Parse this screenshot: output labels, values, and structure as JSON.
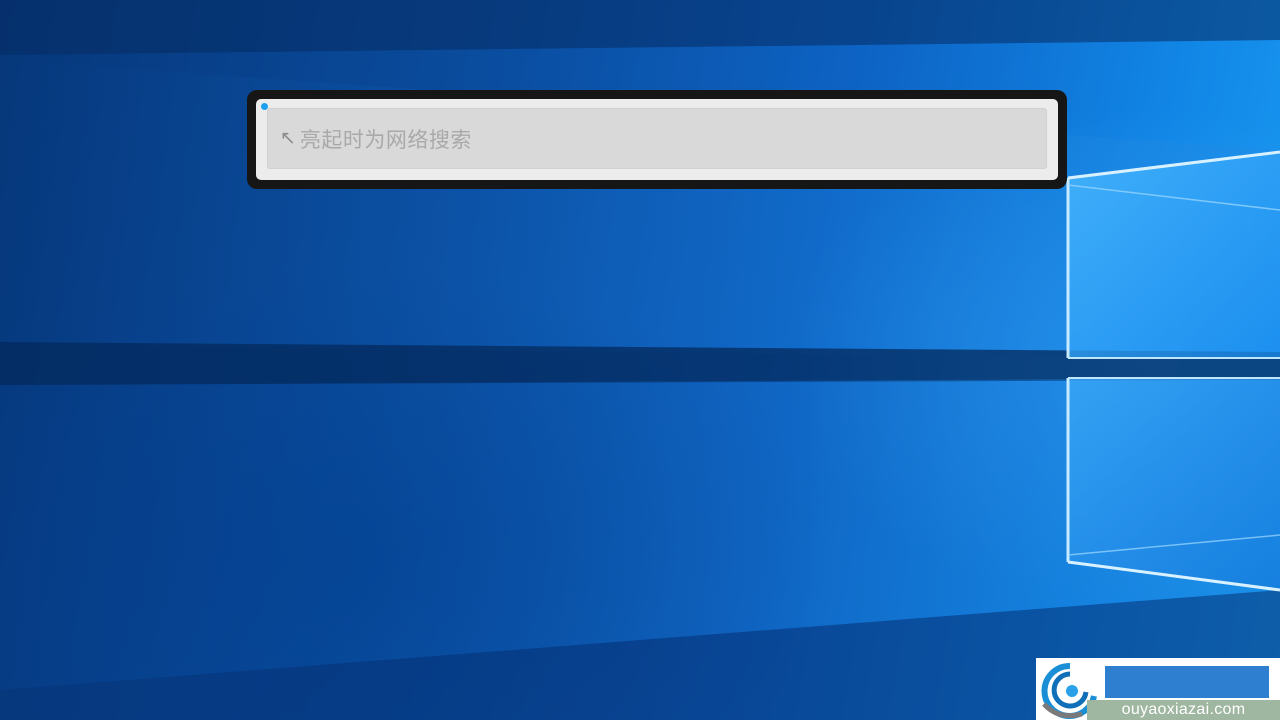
{
  "search": {
    "cursor_glyph": "↖",
    "placeholder": "亮起时为网络搜索"
  },
  "watermark": {
    "site": "ouyaoxiazai.com"
  },
  "colors": {
    "wallpaper_dark": "#06377a",
    "wallpaper_light": "#1a9cf2",
    "frame": "#161616",
    "panel": "#ececec",
    "field": "#d9d9d9",
    "placeholder": "#a9a9a9",
    "focus_dot": "#1ea0f0"
  },
  "icons": {
    "cursor": "arrow-cursor-icon",
    "logo": "swirl-logo-icon"
  }
}
